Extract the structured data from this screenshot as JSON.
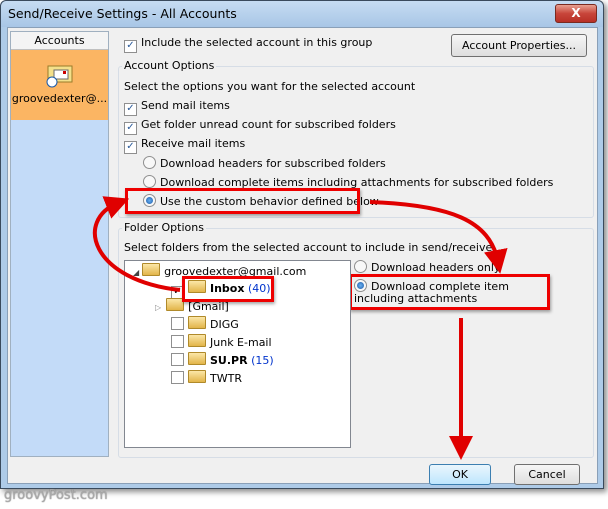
{
  "window": {
    "title": "Send/Receive Settings - All Accounts",
    "close_label": "X"
  },
  "accounts": {
    "header": "Accounts",
    "items": [
      {
        "name": "groovedexter@...",
        "icon": "mail-account-icon",
        "selected": true
      }
    ]
  },
  "include_account": {
    "label": "Include the selected account in this group",
    "checked": true
  },
  "account_properties_button": "Account Properties...",
  "account_options": {
    "legend": "Account Options",
    "description": "Select the options you want for the selected account",
    "send_mail": {
      "label": "Send mail items",
      "checked": true
    },
    "get_unread": {
      "label": "Get folder unread count for subscribed folders",
      "checked": true
    },
    "receive_mail": {
      "label": "Receive mail items",
      "checked": true
    },
    "radios": [
      {
        "label": "Download headers for subscribed folders",
        "selected": false
      },
      {
        "label": "Download complete items including attachments for subscribed folders",
        "selected": false
      },
      {
        "label": "Use the custom behavior defined below",
        "selected": true
      }
    ]
  },
  "folder_options": {
    "legend": "Folder Options",
    "description": "Select folders from the selected account to include in send/receive",
    "tree": {
      "root": "groovedexter@gmail.com",
      "folders": [
        {
          "name": "Inbox",
          "count": "(40)",
          "checked": true,
          "bold": true
        },
        {
          "name": "[Gmail]",
          "count": "",
          "expandable": true
        },
        {
          "name": "DIGG",
          "count": "",
          "checked": false
        },
        {
          "name": "Junk E-mail",
          "count": "",
          "checked": false
        },
        {
          "name": "SU.PR",
          "count": "(15)",
          "checked": false,
          "bold": true
        },
        {
          "name": "TWTR",
          "count": "",
          "checked": false
        }
      ]
    },
    "radios": [
      {
        "label": "Download headers only",
        "selected": false
      },
      {
        "label": "Download complete item including attachments",
        "selected": true
      }
    ]
  },
  "buttons": {
    "ok": "OK",
    "cancel": "Cancel"
  },
  "watermark": "groovyPost.com",
  "annotation_color": "#e00000"
}
